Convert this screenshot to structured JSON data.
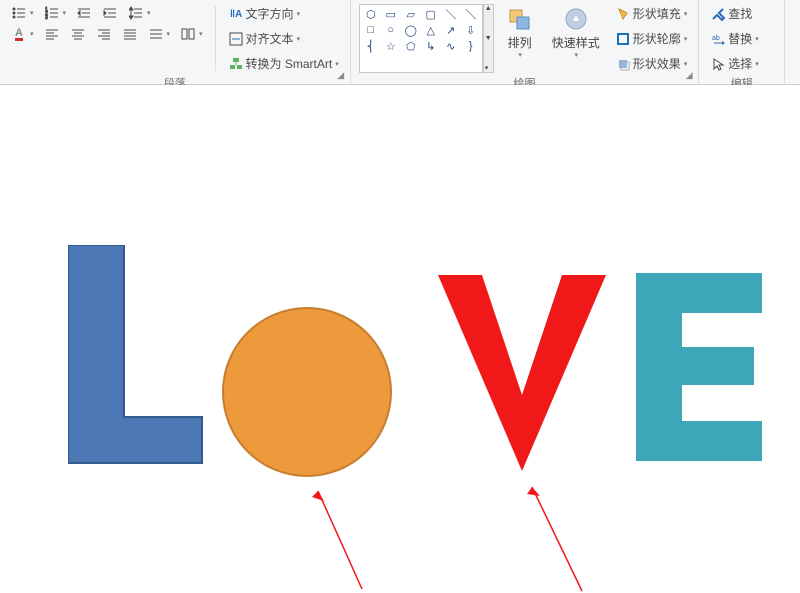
{
  "ribbon": {
    "paragraph": {
      "label": "段落",
      "text_direction": "文字方向",
      "align_text": "对齐文本",
      "convert_smartart": "转换为 SmartArt"
    },
    "drawing": {
      "label": "绘图",
      "arrange": "排列",
      "quick_styles": "快速样式",
      "shape_fill": "形状填充",
      "shape_outline": "形状轮廓",
      "shape_effects": "形状效果"
    },
    "editing": {
      "label": "编辑",
      "find": "查找",
      "replace": "替换",
      "select": "选择"
    }
  },
  "chart_data": null
}
